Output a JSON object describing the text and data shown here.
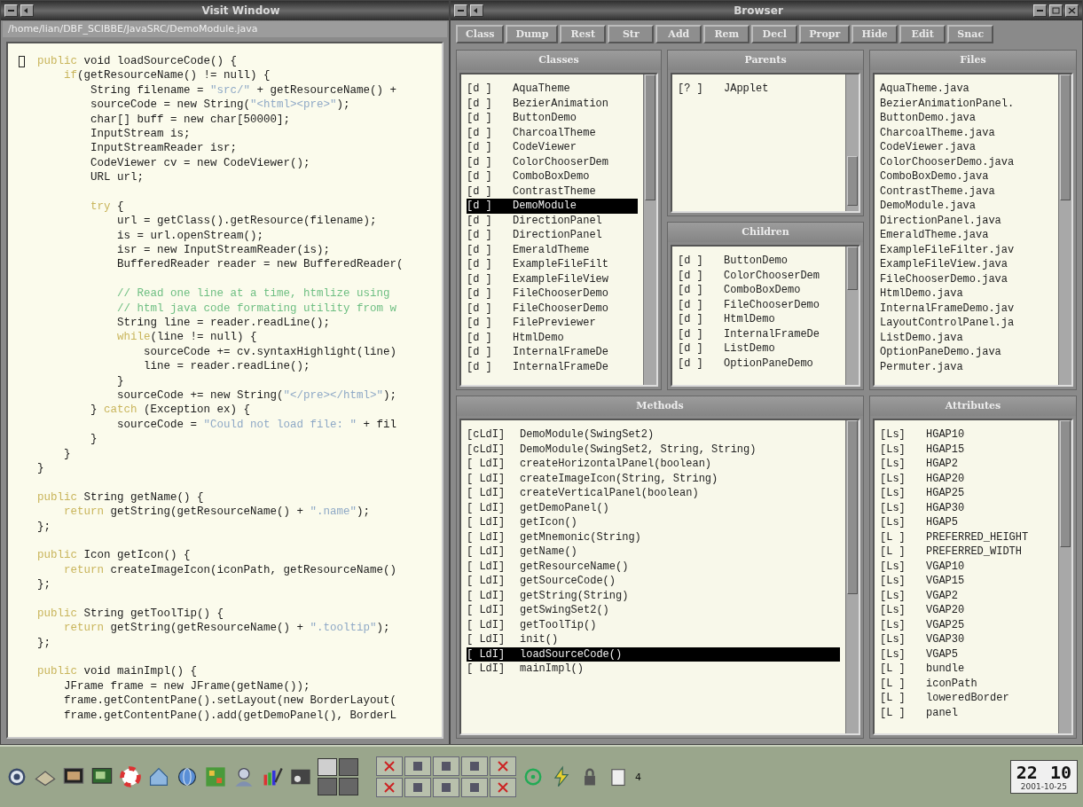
{
  "code_window": {
    "title": "Visit Window",
    "path": "/home/lian/DBF_SCIBBE/JavaSRC/DemoModule.java",
    "lines": [
      {
        "kind": "code",
        "spans": [
          {
            "text": "public",
            "kind": "keyword"
          },
          {
            "text": " void loadSourceCode() {",
            "kind": "plain"
          }
        ]
      },
      {
        "kind": "code",
        "spans": [
          {
            "text": "    if",
            "kind": "keyword"
          },
          {
            "text": "(getResourceName() != null) {",
            "kind": "plain"
          }
        ]
      },
      {
        "kind": "code",
        "spans": [
          {
            "text": "        String filename = ",
            "kind": "plain"
          },
          {
            "text": "\"src/\"",
            "kind": "string"
          },
          {
            "text": " + getResourceName() +",
            "kind": "plain"
          }
        ]
      },
      {
        "kind": "code",
        "spans": [
          {
            "text": "        sourceCode = new String(",
            "kind": "plain"
          },
          {
            "text": "\"<html><pre>\"",
            "kind": "string"
          },
          {
            "text": ");",
            "kind": "plain"
          }
        ]
      },
      {
        "kind": "code",
        "spans": [
          {
            "text": "        char[] buff = new char[50000];",
            "kind": "plain"
          }
        ]
      },
      {
        "kind": "code",
        "spans": [
          {
            "text": "        InputStream is;",
            "kind": "plain"
          }
        ]
      },
      {
        "kind": "code",
        "spans": [
          {
            "text": "        InputStreamReader isr;",
            "kind": "plain"
          }
        ]
      },
      {
        "kind": "code",
        "spans": [
          {
            "text": "        CodeViewer cv = new CodeViewer();",
            "kind": "plain"
          }
        ]
      },
      {
        "kind": "code",
        "spans": [
          {
            "text": "        URL url;",
            "kind": "plain"
          }
        ]
      },
      {
        "kind": "blank"
      },
      {
        "kind": "code",
        "spans": [
          {
            "text": "        try",
            "kind": "keyword"
          },
          {
            "text": " {",
            "kind": "plain"
          }
        ]
      },
      {
        "kind": "code",
        "spans": [
          {
            "text": "            url = getClass().getResource(filename);",
            "kind": "plain"
          }
        ]
      },
      {
        "kind": "code",
        "spans": [
          {
            "text": "            is = url.openStream();",
            "kind": "plain"
          }
        ]
      },
      {
        "kind": "code",
        "spans": [
          {
            "text": "            isr = new InputStreamReader(is);",
            "kind": "plain"
          }
        ]
      },
      {
        "kind": "code",
        "spans": [
          {
            "text": "            BufferedReader reader = new BufferedReader(",
            "kind": "plain"
          }
        ]
      },
      {
        "kind": "blank"
      },
      {
        "kind": "code",
        "spans": [
          {
            "text": "            // Read one line at a time, htmlize using",
            "kind": "comment"
          }
        ]
      },
      {
        "kind": "code",
        "spans": [
          {
            "text": "            // html java code formating utility from w",
            "kind": "comment"
          }
        ]
      },
      {
        "kind": "code",
        "spans": [
          {
            "text": "            String line = reader.readLine();",
            "kind": "plain"
          }
        ]
      },
      {
        "kind": "code",
        "spans": [
          {
            "text": "            while",
            "kind": "keyword"
          },
          {
            "text": "(line != null) {",
            "kind": "plain"
          }
        ]
      },
      {
        "kind": "code",
        "spans": [
          {
            "text": "                sourceCode += cv.syntaxHighlight(line)",
            "kind": "plain"
          }
        ]
      },
      {
        "kind": "code",
        "spans": [
          {
            "text": "                line = reader.readLine();",
            "kind": "plain"
          }
        ]
      },
      {
        "kind": "code",
        "spans": [
          {
            "text": "            }",
            "kind": "plain"
          }
        ]
      },
      {
        "kind": "code",
        "spans": [
          {
            "text": "            sourceCode += new String(",
            "kind": "plain"
          },
          {
            "text": "\"</pre></html>\"",
            "kind": "string"
          },
          {
            "text": ");",
            "kind": "plain"
          }
        ]
      },
      {
        "kind": "code",
        "spans": [
          {
            "text": "        } ",
            "kind": "plain"
          },
          {
            "text": "catch",
            "kind": "keyword"
          },
          {
            "text": " (Exception ex) {",
            "kind": "plain"
          }
        ]
      },
      {
        "kind": "code",
        "spans": [
          {
            "text": "            sourceCode = ",
            "kind": "plain"
          },
          {
            "text": "\"Could not load file: \"",
            "kind": "string"
          },
          {
            "text": " + fil",
            "kind": "plain"
          }
        ]
      },
      {
        "kind": "code",
        "spans": [
          {
            "text": "        }",
            "kind": "plain"
          }
        ]
      },
      {
        "kind": "code",
        "spans": [
          {
            "text": "    }",
            "kind": "plain"
          }
        ]
      },
      {
        "kind": "code",
        "spans": [
          {
            "text": "}",
            "kind": "plain"
          }
        ]
      },
      {
        "kind": "blank"
      },
      {
        "kind": "code",
        "spans": [
          {
            "text": "public",
            "kind": "keyword"
          },
          {
            "text": " String getName() {",
            "kind": "plain"
          }
        ]
      },
      {
        "kind": "code",
        "spans": [
          {
            "text": "    return",
            "kind": "keyword"
          },
          {
            "text": " getString(getResourceName() + ",
            "kind": "plain"
          },
          {
            "text": "\".name\"",
            "kind": "string"
          },
          {
            "text": ");",
            "kind": "plain"
          }
        ]
      },
      {
        "kind": "code",
        "spans": [
          {
            "text": "};",
            "kind": "plain"
          }
        ]
      },
      {
        "kind": "blank"
      },
      {
        "kind": "code",
        "spans": [
          {
            "text": "public",
            "kind": "keyword"
          },
          {
            "text": " Icon getIcon() {",
            "kind": "plain"
          }
        ]
      },
      {
        "kind": "code",
        "spans": [
          {
            "text": "    return",
            "kind": "keyword"
          },
          {
            "text": " createImageIcon(iconPath, getResourceName()",
            "kind": "plain"
          }
        ]
      },
      {
        "kind": "code",
        "spans": [
          {
            "text": "};",
            "kind": "plain"
          }
        ]
      },
      {
        "kind": "blank"
      },
      {
        "kind": "code",
        "spans": [
          {
            "text": "public",
            "kind": "keyword"
          },
          {
            "text": " String getToolTip() {",
            "kind": "plain"
          }
        ]
      },
      {
        "kind": "code",
        "spans": [
          {
            "text": "    return",
            "kind": "keyword"
          },
          {
            "text": " getString(getResourceName() + ",
            "kind": "plain"
          },
          {
            "text": "\".tooltip\"",
            "kind": "string"
          },
          {
            "text": ");",
            "kind": "plain"
          }
        ]
      },
      {
        "kind": "code",
        "spans": [
          {
            "text": "};",
            "kind": "plain"
          }
        ]
      },
      {
        "kind": "blank"
      },
      {
        "kind": "code",
        "spans": [
          {
            "text": "public",
            "kind": "keyword"
          },
          {
            "text": " void mainImpl() {",
            "kind": "plain"
          }
        ]
      },
      {
        "kind": "code",
        "spans": [
          {
            "text": "    JFrame frame = new JFrame(getName());",
            "kind": "plain"
          }
        ]
      },
      {
        "kind": "code",
        "spans": [
          {
            "text": "    frame.getContentPane().setLayout(new BorderLayout(",
            "kind": "plain"
          }
        ]
      },
      {
        "kind": "code",
        "spans": [
          {
            "text": "    frame.getContentPane().add(getDemoPanel(), BorderL",
            "kind": "plain"
          }
        ]
      }
    ]
  },
  "browser": {
    "title": "Browser",
    "toolbar": [
      "Class",
      "Dump",
      "Rest",
      "Str",
      "Add",
      "Rem",
      "Decl",
      "Propr",
      "Hide",
      "Edit",
      "Snac"
    ],
    "classes": {
      "title": "Classes",
      "items": [
        {
          "flag": "[d ]",
          "name": "AquaTheme",
          "selected": false
        },
        {
          "flag": "[d ]",
          "name": "BezierAnimation",
          "selected": false
        },
        {
          "flag": "[d ]",
          "name": "ButtonDemo",
          "selected": false
        },
        {
          "flag": "[d ]",
          "name": "CharcoalTheme",
          "selected": false
        },
        {
          "flag": "[d ]",
          "name": "CodeViewer",
          "selected": false
        },
        {
          "flag": "[d ]",
          "name": "ColorChooserDem",
          "selected": false
        },
        {
          "flag": "[d ]",
          "name": "ComboBoxDemo",
          "selected": false
        },
        {
          "flag": "[d ]",
          "name": "ContrastTheme",
          "selected": false
        },
        {
          "flag": "[d ]",
          "name": "DemoModule",
          "selected": true
        },
        {
          "flag": "[d ]",
          "name": "DirectionPanel",
          "selected": false
        },
        {
          "flag": "[d ]",
          "name": "DirectionPanel",
          "selected": false
        },
        {
          "flag": "[d ]",
          "name": "EmeraldTheme",
          "selected": false
        },
        {
          "flag": "[d ]",
          "name": "ExampleFileFilt",
          "selected": false
        },
        {
          "flag": "[d ]",
          "name": "ExampleFileView",
          "selected": false
        },
        {
          "flag": "[d ]",
          "name": "FileChooserDemo",
          "selected": false
        },
        {
          "flag": "[d ]",
          "name": "FileChooserDemo",
          "selected": false
        },
        {
          "flag": "[d ]",
          "name": "FilePreviewer",
          "selected": false
        },
        {
          "flag": "[d ]",
          "name": "HtmlDemo",
          "selected": false
        },
        {
          "flag": "[d ]",
          "name": "InternalFrameDe",
          "selected": false
        },
        {
          "flag": "[d ]",
          "name": "InternalFrameDe",
          "selected": false
        }
      ]
    },
    "parents": {
      "title": "Parents",
      "items": [
        {
          "flag": "[? ]",
          "name": "JApplet",
          "selected": false
        }
      ]
    },
    "children": {
      "title": "Children",
      "items": [
        {
          "flag": "[d ]",
          "name": "ButtonDemo",
          "selected": false
        },
        {
          "flag": "[d ]",
          "name": "ColorChooserDem",
          "selected": false
        },
        {
          "flag": "[d ]",
          "name": "ComboBoxDemo",
          "selected": false
        },
        {
          "flag": "[d ]",
          "name": "FileChooserDemo",
          "selected": false
        },
        {
          "flag": "[d ]",
          "name": "HtmlDemo",
          "selected": false
        },
        {
          "flag": "[d ]",
          "name": "InternalFrameDe",
          "selected": false
        },
        {
          "flag": "[d ]",
          "name": "ListDemo",
          "selected": false
        },
        {
          "flag": "[d ]",
          "name": "OptionPaneDemo",
          "selected": false
        }
      ]
    },
    "files": {
      "title": "Files",
      "items": [
        {
          "name": "AquaTheme.java",
          "selected": false
        },
        {
          "name": "BezierAnimationPanel.",
          "selected": false
        },
        {
          "name": "ButtonDemo.java",
          "selected": false
        },
        {
          "name": "CharcoalTheme.java",
          "selected": false
        },
        {
          "name": "CodeViewer.java",
          "selected": false
        },
        {
          "name": "ColorChooserDemo.java",
          "selected": false
        },
        {
          "name": "ComboBoxDemo.java",
          "selected": false
        },
        {
          "name": "ContrastTheme.java",
          "selected": false
        },
        {
          "name": "DemoModule.java",
          "selected": false
        },
        {
          "name": "DirectionPanel.java",
          "selected": false
        },
        {
          "name": "EmeraldTheme.java",
          "selected": false
        },
        {
          "name": "ExampleFileFilter.jav",
          "selected": false
        },
        {
          "name": "ExampleFileView.java",
          "selected": false
        },
        {
          "name": "FileChooserDemo.java",
          "selected": false
        },
        {
          "name": "HtmlDemo.java",
          "selected": false
        },
        {
          "name": "InternalFrameDemo.jav",
          "selected": false
        },
        {
          "name": "LayoutControlPanel.ja",
          "selected": false
        },
        {
          "name": "ListDemo.java",
          "selected": false
        },
        {
          "name": "OptionPaneDemo.java",
          "selected": false
        },
        {
          "name": "Permuter.java",
          "selected": false
        }
      ]
    },
    "methods": {
      "title": "Methods",
      "items": [
        {
          "flag": "[cLdI]",
          "name": "DemoModule(SwingSet2)",
          "selected": false
        },
        {
          "flag": "[cLdI]",
          "name": "DemoModule(SwingSet2, String, String)",
          "selected": false
        },
        {
          "flag": "[ LdI]",
          "name": "createHorizontalPanel(boolean)",
          "selected": false
        },
        {
          "flag": "[ LdI]",
          "name": "createImageIcon(String, String)",
          "selected": false
        },
        {
          "flag": "[ LdI]",
          "name": "createVerticalPanel(boolean)",
          "selected": false
        },
        {
          "flag": "[ LdI]",
          "name": "getDemoPanel()",
          "selected": false
        },
        {
          "flag": "[ LdI]",
          "name": "getIcon()",
          "selected": false
        },
        {
          "flag": "[ LdI]",
          "name": "getMnemonic(String)",
          "selected": false
        },
        {
          "flag": "[ LdI]",
          "name": "getName()",
          "selected": false
        },
        {
          "flag": "[ LdI]",
          "name": "getResourceName()",
          "selected": false
        },
        {
          "flag": "[ LdI]",
          "name": "getSourceCode()",
          "selected": false
        },
        {
          "flag": "[ LdI]",
          "name": "getString(String)",
          "selected": false
        },
        {
          "flag": "[ LdI]",
          "name": "getSwingSet2()",
          "selected": false
        },
        {
          "flag": "[ LdI]",
          "name": "getToolTip()",
          "selected": false
        },
        {
          "flag": "[ LdI]",
          "name": "init()",
          "selected": false
        },
        {
          "flag": "[ LdI]",
          "name": "loadSourceCode()",
          "selected": true
        },
        {
          "flag": "[ LdI]",
          "name": "mainImpl()",
          "selected": false
        }
      ]
    },
    "attributes": {
      "title": "Attributes",
      "items": [
        {
          "flag": "[Ls]",
          "name": "HGAP10",
          "selected": false
        },
        {
          "flag": "[Ls]",
          "name": "HGAP15",
          "selected": false
        },
        {
          "flag": "[Ls]",
          "name": "HGAP2",
          "selected": false
        },
        {
          "flag": "[Ls]",
          "name": "HGAP20",
          "selected": false
        },
        {
          "flag": "[Ls]",
          "name": "HGAP25",
          "selected": false
        },
        {
          "flag": "[Ls]",
          "name": "HGAP30",
          "selected": false
        },
        {
          "flag": "[Ls]",
          "name": "HGAP5",
          "selected": false
        },
        {
          "flag": "[L ]",
          "name": "PREFERRED_HEIGHT",
          "selected": false
        },
        {
          "flag": "[L ]",
          "name": "PREFERRED_WIDTH",
          "selected": false
        },
        {
          "flag": "[Ls]",
          "name": "VGAP10",
          "selected": false
        },
        {
          "flag": "[Ls]",
          "name": "VGAP15",
          "selected": false
        },
        {
          "flag": "[Ls]",
          "name": "VGAP2",
          "selected": false
        },
        {
          "flag": "[Ls]",
          "name": "VGAP20",
          "selected": false
        },
        {
          "flag": "[Ls]",
          "name": "VGAP25",
          "selected": false
        },
        {
          "flag": "[Ls]",
          "name": "VGAP30",
          "selected": false
        },
        {
          "flag": "[Ls]",
          "name": "VGAP5",
          "selected": false
        },
        {
          "flag": "[L ]",
          "name": "bundle",
          "selected": false
        },
        {
          "flag": "[L ]",
          "name": "iconPath",
          "selected": false
        },
        {
          "flag": "[L ]",
          "name": "loweredBorder",
          "selected": false
        },
        {
          "flag": "[L ]",
          "name": "panel",
          "selected": false
        }
      ]
    }
  },
  "taskbar": {
    "desktop_number": "4",
    "clock": {
      "hours": "22",
      "minutes": "10",
      "date": "2001-10-25"
    }
  }
}
